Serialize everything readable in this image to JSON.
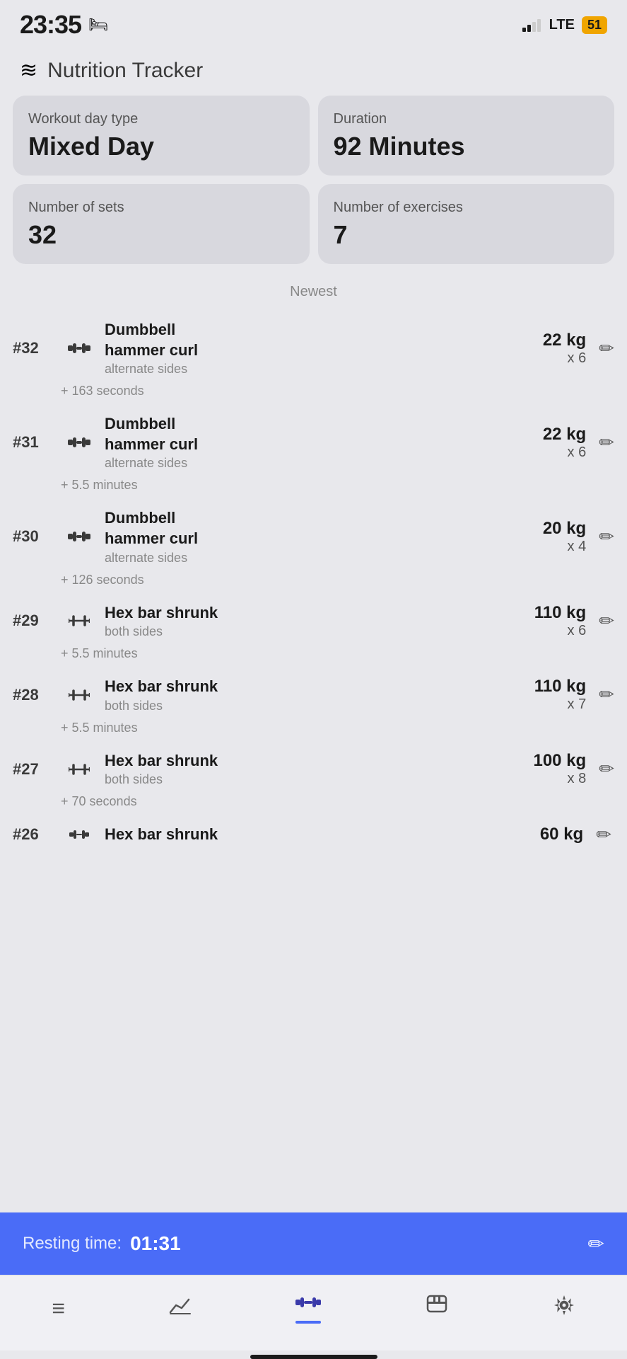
{
  "status": {
    "time": "23:35",
    "battery": "51",
    "lte": "LTE",
    "signal_bars": [
      4,
      7,
      11,
      14
    ],
    "bed_icon": "🛏"
  },
  "header": {
    "icon": "🍽",
    "title": "Nutrition Tracker"
  },
  "stats": {
    "workout_type_label": "Workout day type",
    "workout_type_value": "Mixed Day",
    "duration_label": "Duration",
    "duration_value": "92 Minutes",
    "sets_label": "Number of sets",
    "sets_value": "32",
    "exercises_label": "Number of exercises",
    "exercises_value": "7"
  },
  "section_label": "Newest",
  "exercises": [
    {
      "number": "#32",
      "icon": "dumbbell",
      "name": "Dumbbell\nhammer curl",
      "subtitle": "alternate sides",
      "weight": "22 kg",
      "reps": "x 6",
      "time_gap": "+ 163 seconds"
    },
    {
      "number": "#31",
      "icon": "dumbbell",
      "name": "Dumbbell\nhammer curl",
      "subtitle": "alternate sides",
      "weight": "22 kg",
      "reps": "x 6",
      "time_gap": "+ 5.5 minutes"
    },
    {
      "number": "#30",
      "icon": "dumbbell",
      "name": "Dumbbell\nhammer curl",
      "subtitle": "alternate sides",
      "weight": "20 kg",
      "reps": "x 4",
      "time_gap": "+ 126 seconds"
    },
    {
      "number": "#29",
      "icon": "hex",
      "name": "Hex bar shrunk",
      "subtitle": "both sides",
      "weight": "110 kg",
      "reps": "x 6",
      "time_gap": "+ 5.5 minutes"
    },
    {
      "number": "#28",
      "icon": "hex",
      "name": "Hex bar shrunk",
      "subtitle": "both sides",
      "weight": "110 kg",
      "reps": "x 7",
      "time_gap": "+ 5.5 minutes"
    },
    {
      "number": "#27",
      "icon": "hex",
      "name": "Hex bar shrunk",
      "subtitle": "both sides",
      "weight": "100 kg",
      "reps": "x 8",
      "time_gap": "+ 70 seconds"
    }
  ],
  "partial_exercise": {
    "number": "#26",
    "icon": "hex",
    "name": "Hex bar shrunk",
    "weight": "60 kg"
  },
  "resting": {
    "label": "Resting time:",
    "time": "01:31"
  },
  "bottom_nav": {
    "items": [
      {
        "name": "list",
        "icon": "≡",
        "label": "list"
      },
      {
        "name": "chart",
        "icon": "📈",
        "label": "chart"
      },
      {
        "name": "workout",
        "icon": "🏋",
        "label": "workout",
        "active": true
      },
      {
        "name": "nutrition",
        "icon": "📦",
        "label": "nutrition"
      },
      {
        "name": "settings",
        "icon": "⚙",
        "label": "settings"
      }
    ]
  }
}
